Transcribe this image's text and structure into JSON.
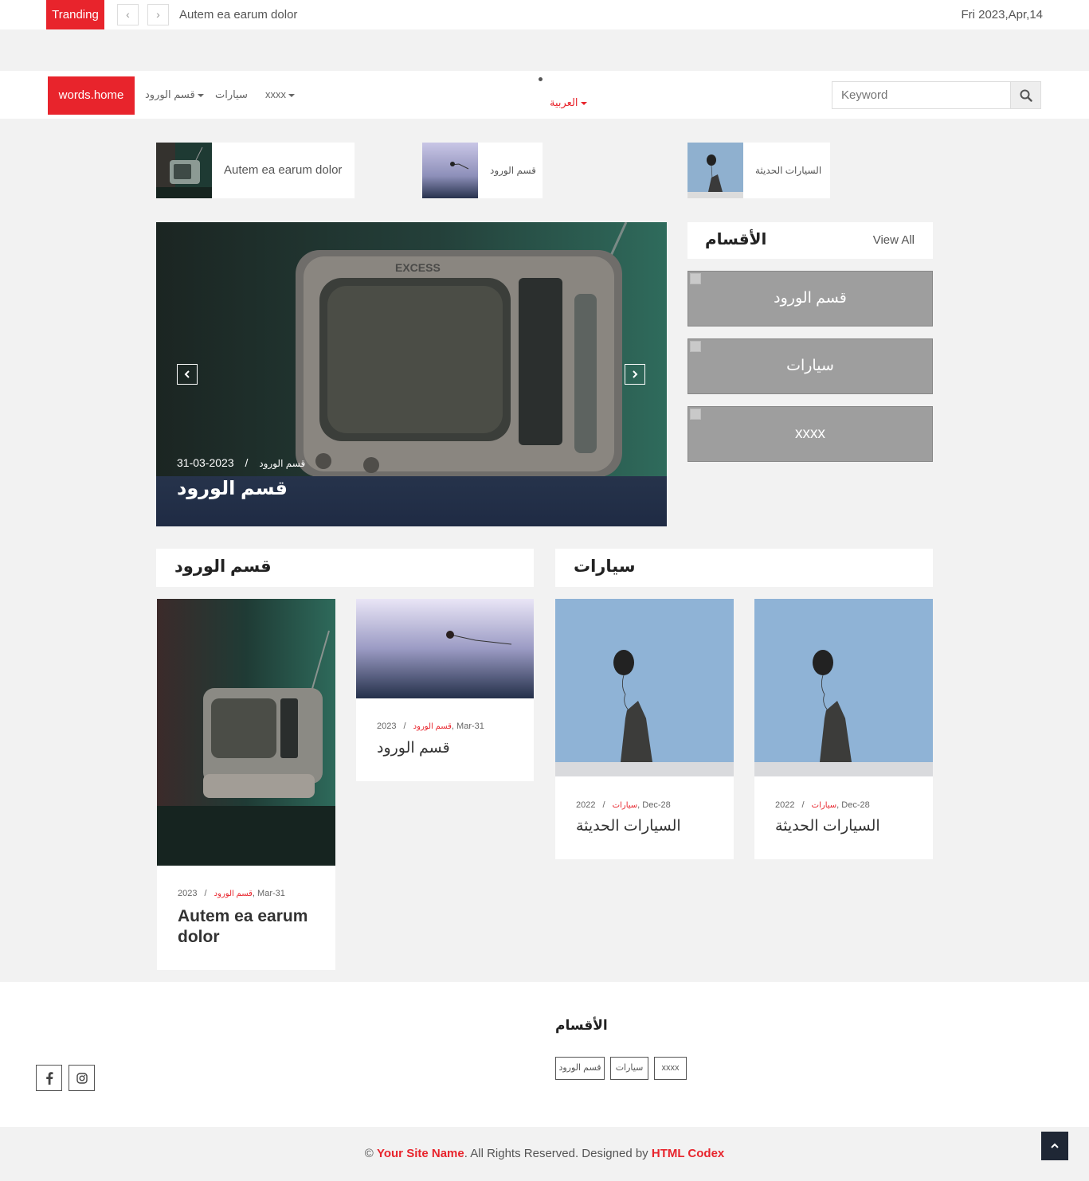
{
  "topbar": {
    "trending_label": "Tranding",
    "prev_arrow": "‹",
    "next_arrow": "›",
    "trending_text": "Autem ea earum dolor",
    "date": "Fri 2023,Apr,14"
  },
  "navbar": {
    "brand": "words.home",
    "items": [
      {
        "label": "قسم الورود",
        "dropdown": true
      },
      {
        "label": "سيارات",
        "dropdown": false
      },
      {
        "label": "xxxx",
        "dropdown": true
      }
    ],
    "language": "العربية",
    "search_placeholder": "Keyword",
    "search_icon": "search-icon"
  },
  "mini_news": [
    {
      "title": "Autem ea earum dolor"
    },
    {
      "title": "قسم الورود"
    },
    {
      "title": "السيارات الحديثة"
    }
  ],
  "carousel": {
    "date": "31-03-2023",
    "separator": "/",
    "category": "قسم الورود",
    "title": "قسم الورود"
  },
  "categories": {
    "heading": "الأقسام",
    "view_all": "View All",
    "items": [
      "قسم الورود",
      "سيارات",
      "xxxx"
    ]
  },
  "sections": [
    {
      "heading": "قسم الورود",
      "cards": [
        {
          "year": "2023",
          "category": "قسم الورود",
          "date": ", Mar-31",
          "title": "Autem ea earum dolor"
        },
        {
          "year": "2023",
          "category": "قسم الورود",
          "date": ", Mar-31",
          "title": "قسم الورود"
        }
      ]
    },
    {
      "heading": "سيارات",
      "cards": [
        {
          "year": "2022",
          "category": "سيارات",
          "date": ", Dec-28",
          "title": "السيارات الحديثة"
        },
        {
          "year": "2022",
          "category": "سيارات",
          "date": ", Dec-28",
          "title": "السيارات الحديثة"
        }
      ]
    }
  ],
  "meta_separator": "/",
  "footer": {
    "social": [
      "facebook-icon",
      "instagram-icon"
    ],
    "categories_heading": "الأقسام",
    "tags": [
      "قسم الورود",
      "سيارات",
      "xxxx"
    ],
    "copyright_symbol": "©",
    "site_name": "Your Site Name",
    "rights": ". All Rights Reserved. Designed by ",
    "designer": "HTML Codex"
  },
  "colors": {
    "accent": "#e8242c",
    "dark": "#1f2735",
    "background": "#f2f2f2"
  }
}
